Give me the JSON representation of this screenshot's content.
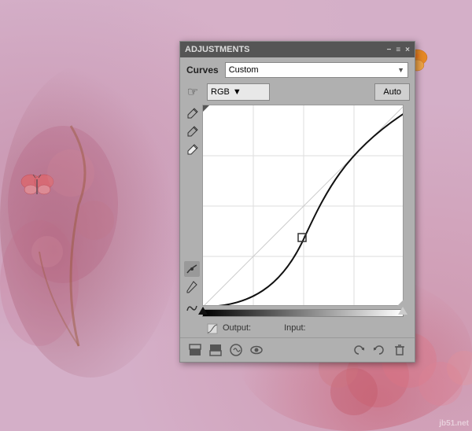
{
  "background": {
    "color": "#d4afc8"
  },
  "panel": {
    "titlebar": {
      "title": "ADJUSTMENTS",
      "minimize_label": "−",
      "close_label": "×",
      "menu_label": "≡"
    },
    "header": {
      "title": "Curves",
      "preset_label": "Custom",
      "preset_arrow": "▼"
    },
    "channel": {
      "label": "RGB",
      "arrow": "▼"
    },
    "auto_button": "Auto",
    "output_section": {
      "output_label": "Output:",
      "output_value": "",
      "input_label": "Input:",
      "input_value": ""
    },
    "footer": {
      "icons": [
        "clip-below-icon",
        "clip-above-icon",
        "auto-adjust-icon",
        "eye-icon",
        "reset-icon",
        "undo-icon",
        "delete-icon"
      ]
    }
  },
  "tools": {
    "pointer_label": "☞",
    "eyedropper_black_label": "✏",
    "eyedropper_gray_label": "✏",
    "eyedropper_white_label": "✏",
    "curve_tool_label": "〜",
    "pencil_tool_label": "✏",
    "smooth_label": "~"
  }
}
